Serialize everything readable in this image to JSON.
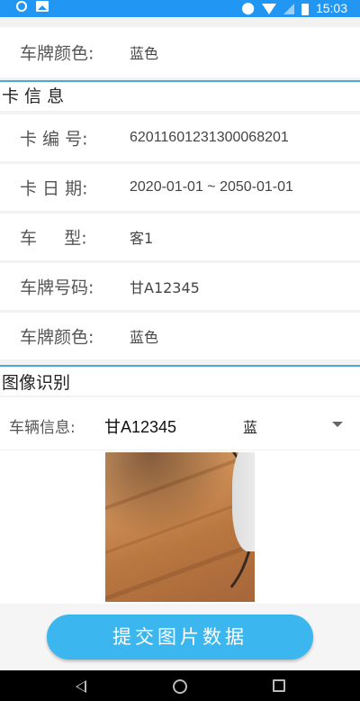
{
  "status_bar": {
    "time": "15:03",
    "icons": [
      "sync-icon",
      "image-icon",
      "location-icon",
      "wifi-icon",
      "signal-icon",
      "battery-icon"
    ]
  },
  "top_row": {
    "label": "车牌颜色:",
    "value": "蓝色"
  },
  "card_info": {
    "title": "卡 信 息",
    "rows": [
      {
        "label": "卡 编 号:",
        "value": "62011601231300068201"
      },
      {
        "label": "卡 日 期:",
        "value": "2020-01-01 ~ 2050-01-01"
      },
      {
        "label": "车     型:",
        "value": "客1"
      },
      {
        "label": "车牌号码:",
        "value": "甘A12345"
      },
      {
        "label": "车牌颜色:",
        "value": "蓝色"
      }
    ]
  },
  "image_recognition": {
    "title": "图像识别",
    "vehicle_label": "车辆信息:",
    "plate": "甘A12345",
    "color_selected": "蓝"
  },
  "submit": {
    "label": "提交图片数据"
  },
  "colors": {
    "accent": "#3bb6ef",
    "status_bar": "#2196f3",
    "divider": "#4ba9df"
  }
}
